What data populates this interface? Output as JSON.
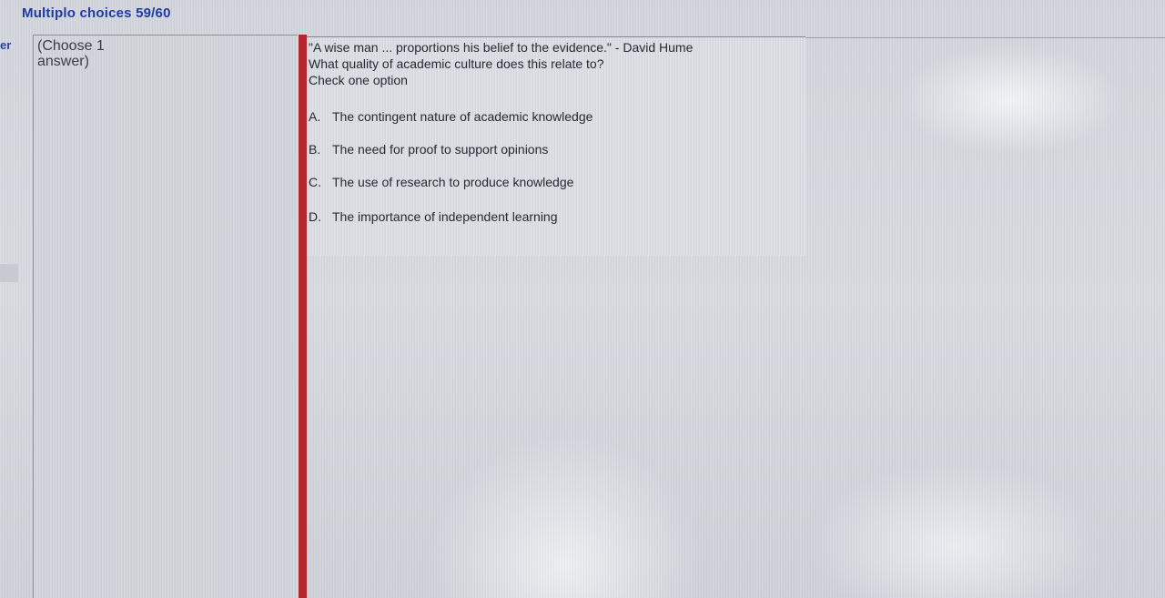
{
  "header": {
    "title": "Multiplo choices 59/60"
  },
  "edge_text": "er",
  "instruction": {
    "line1": "(Choose 1",
    "line2": "answer)"
  },
  "question": {
    "quote": "\"A wise man ... proportions his belief to the evidence.\" - David Hume",
    "prompt": "What quality of academic culture does this relate to?",
    "instruction": "Check one option"
  },
  "options": [
    {
      "letter": "A.",
      "text": "The contingent nature of academic knowledge"
    },
    {
      "letter": "B.",
      "text": "The need for proof to support opinions"
    },
    {
      "letter": "C.",
      "text": "The use of research to produce knowledge"
    },
    {
      "letter": "D.",
      "text": "The importance of independent learning"
    }
  ],
  "colors": {
    "heading": "#1f3aa6",
    "accent_bar": "#b3262c",
    "background": "#d6d9de"
  }
}
